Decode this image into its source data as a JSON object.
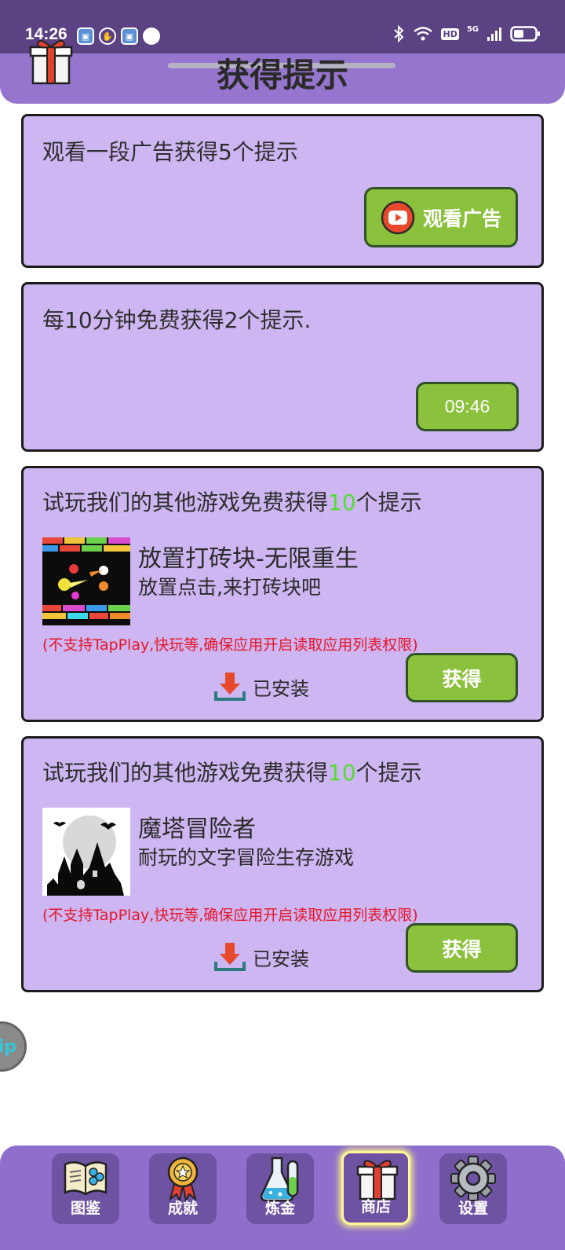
{
  "status_bar": {
    "time": "14:26",
    "network": "5G",
    "hd": "HD"
  },
  "header": {
    "title": "获得提示"
  },
  "cards": {
    "ad": {
      "text": "观看一段广告获得5个提示",
      "button_label": "观看广告"
    },
    "timer": {
      "text": "每10分钟免费获得2个提示.",
      "countdown": "09:46"
    },
    "games": [
      {
        "headline_prefix": "试玩我们的其他游戏免费获得",
        "headline_count": "10",
        "headline_suffix": "个提示",
        "title": "放置打砖块-无限重生",
        "description": "放置点击,来打砖块吧",
        "warning": "(不支持TapPlay,快玩等,确保应用开启读取应用列表权限)",
        "status": "已安装",
        "button_label": "获得"
      },
      {
        "headline_prefix": "试玩我们的其他游戏免费获得",
        "headline_count": "10",
        "headline_suffix": "个提示",
        "title": "魔塔冒险者",
        "description": "耐玩的文字冒险生存游戏",
        "warning": "(不支持TapPlay,快玩等,确保应用开启读取应用列表权限)",
        "status": "已安装",
        "button_label": "获得"
      }
    ]
  },
  "side_bubble": {
    "text": "ip"
  },
  "bottom_nav": {
    "items": [
      {
        "label": "图鉴",
        "icon": "book-icon",
        "active": false
      },
      {
        "label": "成就",
        "icon": "medal-icon",
        "active": false
      },
      {
        "label": "炼金",
        "icon": "flask-icon",
        "active": false
      },
      {
        "label": "商店",
        "icon": "gift-icon",
        "active": true
      },
      {
        "label": "设置",
        "icon": "gear-icon",
        "active": false
      }
    ]
  },
  "colors": {
    "header_bg": "#9575cd",
    "status_bar_bg": "#5b4283",
    "card_bg": "#cdb6f1",
    "button_green": "#8bc13c",
    "highlight_green": "#55dd33",
    "warning_red": "#e8162a",
    "nav_bg": "#8f6fcb",
    "nav_active_glow": "#fff59a"
  }
}
